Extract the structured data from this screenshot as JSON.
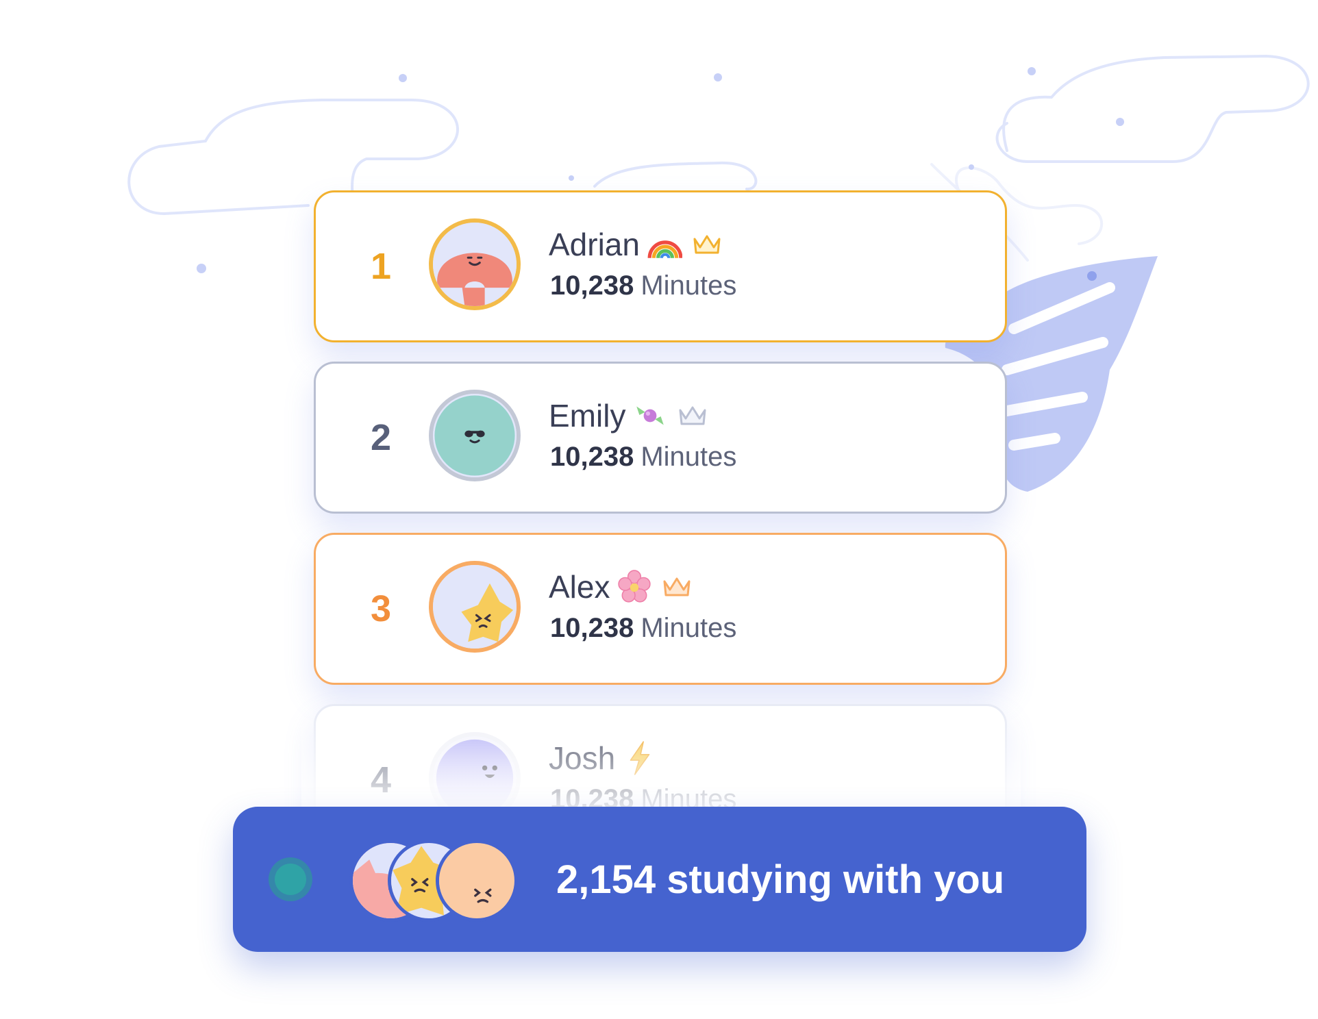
{
  "colors": {
    "gold": "#F2B12F",
    "silver": "#B9BFD2",
    "bronze": "#F8AB63",
    "banner": "#4563CF",
    "online": "#2FA3A6",
    "decoration": "#C3CCF5"
  },
  "leaderboard": {
    "entries": [
      {
        "rank": "1",
        "name": "Adrian",
        "emoji": "rainbow-emoji",
        "badge": "crown-icon",
        "minutes": "10,238",
        "unit": "Minutes"
      },
      {
        "rank": "2",
        "name": "Emily",
        "emoji": "candy-emoji",
        "badge": "crown-icon",
        "minutes": "10,238",
        "unit": "Minutes"
      },
      {
        "rank": "3",
        "name": "Alex",
        "emoji": "cherry-blossom-emoji",
        "badge": "crown-icon",
        "minutes": "10,238",
        "unit": "Minutes"
      },
      {
        "rank": "4",
        "name": "Josh",
        "emoji": "lightning-emoji",
        "minutes": "10,238",
        "unit": "Minutes"
      }
    ]
  },
  "banner": {
    "text": "2,154 studying with you",
    "status_icon": "online-status-dot",
    "avatars": [
      "pink-cat-avatar",
      "yellow-star-avatar",
      "peach-blob-avatar"
    ]
  }
}
